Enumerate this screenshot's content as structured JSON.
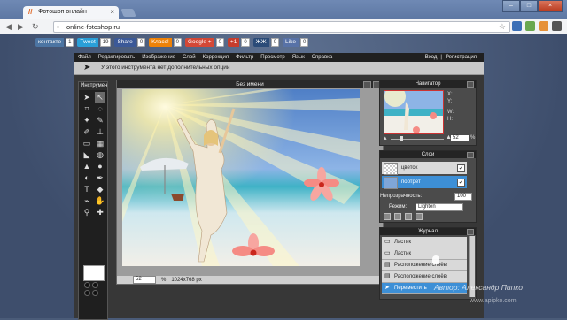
{
  "browser": {
    "tab_title": "Фотошоп онлайн",
    "url": "online-fotoshop.ru"
  },
  "social_buttons": [
    {
      "label": "контакте",
      "count": "1",
      "color": "#4c75a3"
    },
    {
      "label": "Tweet",
      "count": "19",
      "color": "#2a9fd8"
    },
    {
      "label": "Share",
      "count": "0",
      "color": "#3b5998"
    },
    {
      "label": "Класс!",
      "count": "0",
      "color": "#ee8208"
    },
    {
      "label": "Google +",
      "count": "0",
      "color": "#d34836"
    },
    {
      "label": "+1",
      "count": "0",
      "color": "#c63d2d"
    },
    {
      "label": "ЖЖ",
      "count": "0",
      "color": "#2b4b78"
    },
    {
      "label": "Like",
      "count": "0",
      "color": "#5872a7"
    }
  ],
  "menu": {
    "items": [
      "Файл",
      "Редактировать",
      "Изображение",
      "Слой",
      "Коррекция",
      "Фильтр",
      "Просмотр",
      "Язык",
      "Справка"
    ],
    "login": "Вход",
    "separator": "|",
    "register": "Регистрация"
  },
  "options_bar": {
    "text": "У этого инструмента нет дополнительных опций"
  },
  "tools_panel": {
    "title": "Инструмен",
    "tools": [
      "move-tool",
      "select-tool",
      "crop-tool",
      "lasso-tool",
      "wand-tool",
      "pencil-tool",
      "brush-tool",
      "stamp-tool",
      "eraser-tool",
      "gradient-tool",
      "fill-tool",
      "blur-tool",
      "sharpen-tool",
      "dodge-tool",
      "burn-tool",
      "pen-tool",
      "type-tool",
      "shape-tool",
      "eyedropper-tool",
      "hand-tool",
      "zoom-tool",
      "picker-tool"
    ],
    "foreground_color": "#ffffff"
  },
  "document": {
    "title": "Без имени",
    "zoom": "52",
    "zoom_unit": "%",
    "dimensions": "1024x768 px"
  },
  "navigator": {
    "title": "Навигатор",
    "x_label": "X:",
    "y_label": "Y:",
    "w_label": "W:",
    "h_label": "H:",
    "zoom": "52",
    "zoom_unit": "%"
  },
  "layers": {
    "title": "Слои",
    "items": [
      {
        "name": "цветок",
        "selected": false,
        "visible": true
      },
      {
        "name": "портрет",
        "selected": true,
        "visible": true
      }
    ],
    "opacity_label": "Непрозрачность:",
    "opacity_value": "100",
    "mode_label": "Режим:",
    "mode_value": "Lighten"
  },
  "history": {
    "title": "Журнал",
    "items": [
      {
        "label": "Ластик",
        "selected": false
      },
      {
        "label": "Ластик",
        "selected": false
      },
      {
        "label": "Расположение слоёв",
        "selected": false
      },
      {
        "label": "Расположение слоёв",
        "selected": false
      },
      {
        "label": "Переместить",
        "selected": true
      }
    ]
  },
  "watermark": {
    "author": "Автор: Александр Пипко",
    "site": "www.apipko.com"
  },
  "colors": {
    "accent": "#3d8fd6",
    "app_bg": "#373737",
    "menubar_bg": "#202020"
  }
}
